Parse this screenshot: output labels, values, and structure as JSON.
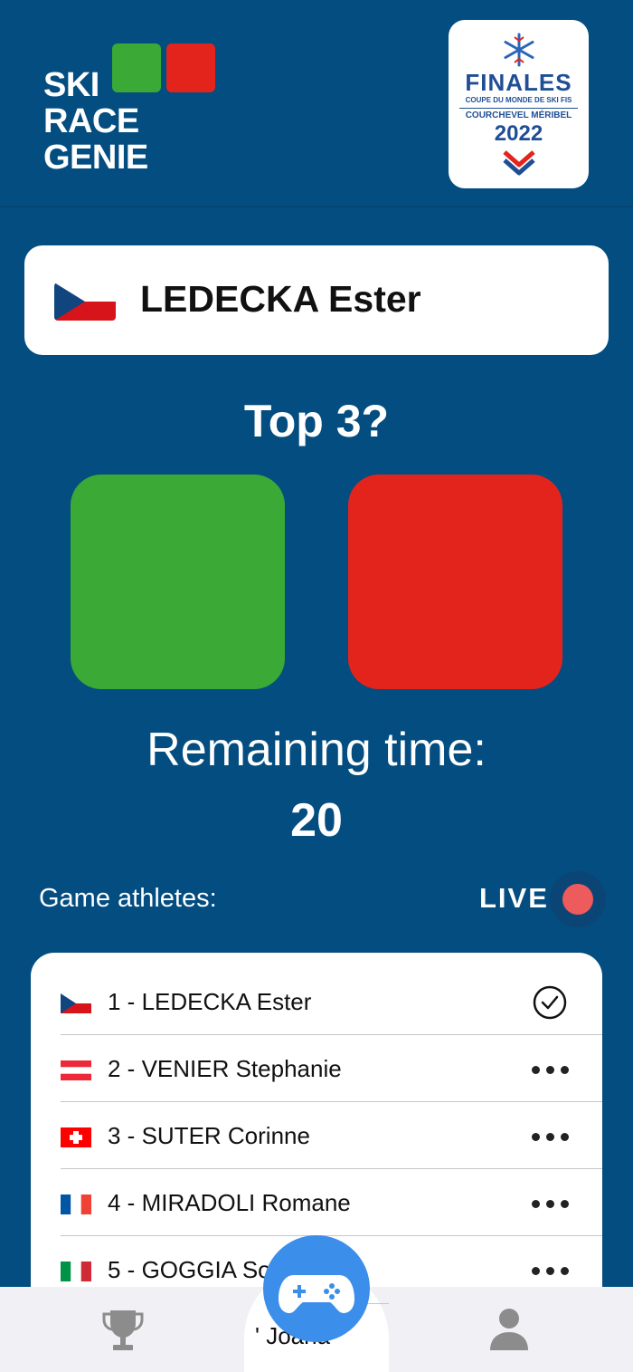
{
  "app": {
    "logo_lines": [
      "SKI",
      "RACE",
      "GENIE"
    ],
    "colors": {
      "background": "#034d80",
      "yes": "#3aa935",
      "no": "#e3241d",
      "live": "#ee5b5c",
      "fab": "#3b8eea"
    }
  },
  "event_badge": {
    "title": "FINALES",
    "subtitle": "COUPE DU MONDE DE SKI FIS",
    "location": "COURCHEVEL MÉRIBEL",
    "year": "2022",
    "icon": "snowflake-icon"
  },
  "current_athlete": {
    "name": "LEDECKA Ester",
    "country_flag": "czech-flag"
  },
  "question": "Top 3?",
  "vote": {
    "yes_color": "#3aa935",
    "no_color": "#e3241d"
  },
  "timer": {
    "label": "Remaining time:",
    "value": "20"
  },
  "athletes_section": {
    "label": "Game athletes:",
    "live_label": "LIVE"
  },
  "athletes": [
    {
      "label": "1 - LEDECKA Ester",
      "flag": "czech-flag",
      "status": "check-icon"
    },
    {
      "label": "2 - VENIER Stephanie",
      "flag": "austria-flag",
      "status": "more-icon"
    },
    {
      "label": "3 - SUTER Corinne",
      "flag": "switzerland-flag",
      "status": "more-icon"
    },
    {
      "label": "4 - MIRADOLI Romane",
      "flag": "france-flag",
      "status": "more-icon"
    },
    {
      "label": "5 - GOGGIA So",
      "flag": "italy-flag",
      "status": "more-icon"
    }
  ],
  "partial_row_text": "' Joana",
  "nav": {
    "left_icon": "trophy-icon",
    "center_icon": "gamepad-icon",
    "right_icon": "user-icon"
  }
}
